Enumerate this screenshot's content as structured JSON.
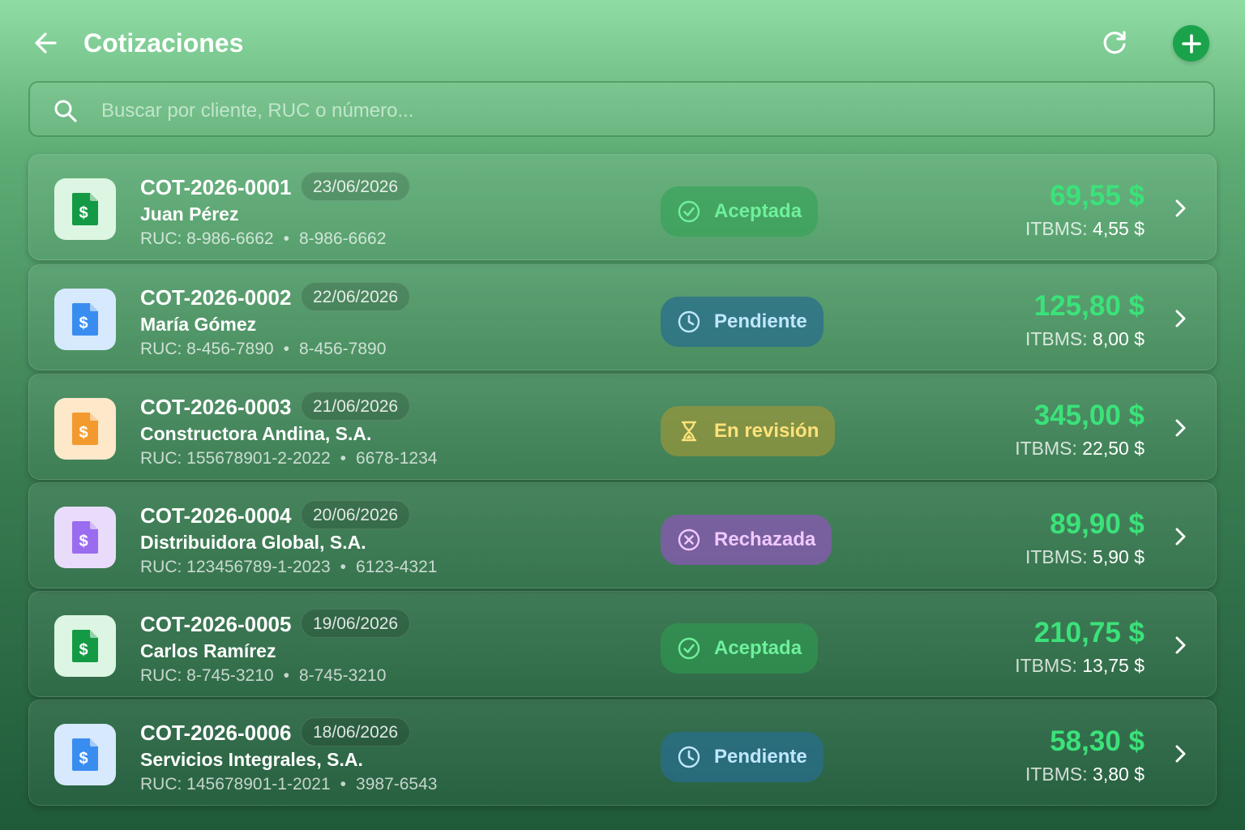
{
  "header": {
    "title": "Cotizaciones",
    "back_icon": "arrow-left-icon",
    "refresh_icon": "refresh-icon",
    "add_icon": "plus-icon"
  },
  "search": {
    "placeholder": "Buscar por cliente, RUC o número...",
    "value": ""
  },
  "colors": {
    "accent_green": "#1aa34a",
    "amount_green": "#3be27a"
  },
  "quotes": [
    {
      "number": "COT-2026-0001",
      "date": "23/06/2026",
      "client": "Juan Pérez",
      "ruc": "RUC: 8-986-6662",
      "phone": "8-986-6662",
      "status": "Aceptada",
      "status_type": "accepted",
      "amount": "69,55 $",
      "tax_label": "ITBMS:",
      "tax": "4,55 $",
      "icon_color": "green"
    },
    {
      "number": "COT-2026-0002",
      "date": "22/06/2026",
      "client": "María Gómez",
      "ruc": "RUC: 8-456-7890",
      "phone": "8-456-7890",
      "status": "Pendiente",
      "status_type": "pending",
      "amount": "125,80 $",
      "tax_label": "ITBMS:",
      "tax": "8,00 $",
      "icon_color": "blue"
    },
    {
      "number": "COT-2026-0003",
      "date": "21/06/2026",
      "client": "Constructora Andina, S.A.",
      "ruc": "RUC: 155678901-2-2022",
      "phone": "6678-1234",
      "status": "En revisión",
      "status_type": "review",
      "amount": "345,00 $",
      "tax_label": "ITBMS:",
      "tax": "22,50 $",
      "icon_color": "orange"
    },
    {
      "number": "COT-2026-0004",
      "date": "20/06/2026",
      "client": "Distribuidora Global, S.A.",
      "ruc": "RUC: 123456789-1-2023",
      "phone": "6123-4321",
      "status": "Rechazada",
      "status_type": "rejected",
      "amount": "89,90 $",
      "tax_label": "ITBMS:",
      "tax": "5,90 $",
      "icon_color": "purple"
    },
    {
      "number": "COT-2026-0005",
      "date": "19/06/2026",
      "client": "Carlos Ramírez",
      "ruc": "RUC: 8-745-3210",
      "phone": "8-745-3210",
      "status": "Aceptada",
      "status_type": "accepted",
      "amount": "210,75 $",
      "tax_label": "ITBMS:",
      "tax": "13,75 $",
      "icon_color": "green"
    },
    {
      "number": "COT-2026-0006",
      "date": "18/06/2026",
      "client": "Servicios Integrales, S.A.",
      "ruc": "RUC: 145678901-1-2021",
      "phone": "3987-6543",
      "status": "Pendiente",
      "status_type": "pending",
      "amount": "58,30 $",
      "tax_label": "ITBMS:",
      "tax": "3,80 $",
      "icon_color": "blue"
    }
  ]
}
